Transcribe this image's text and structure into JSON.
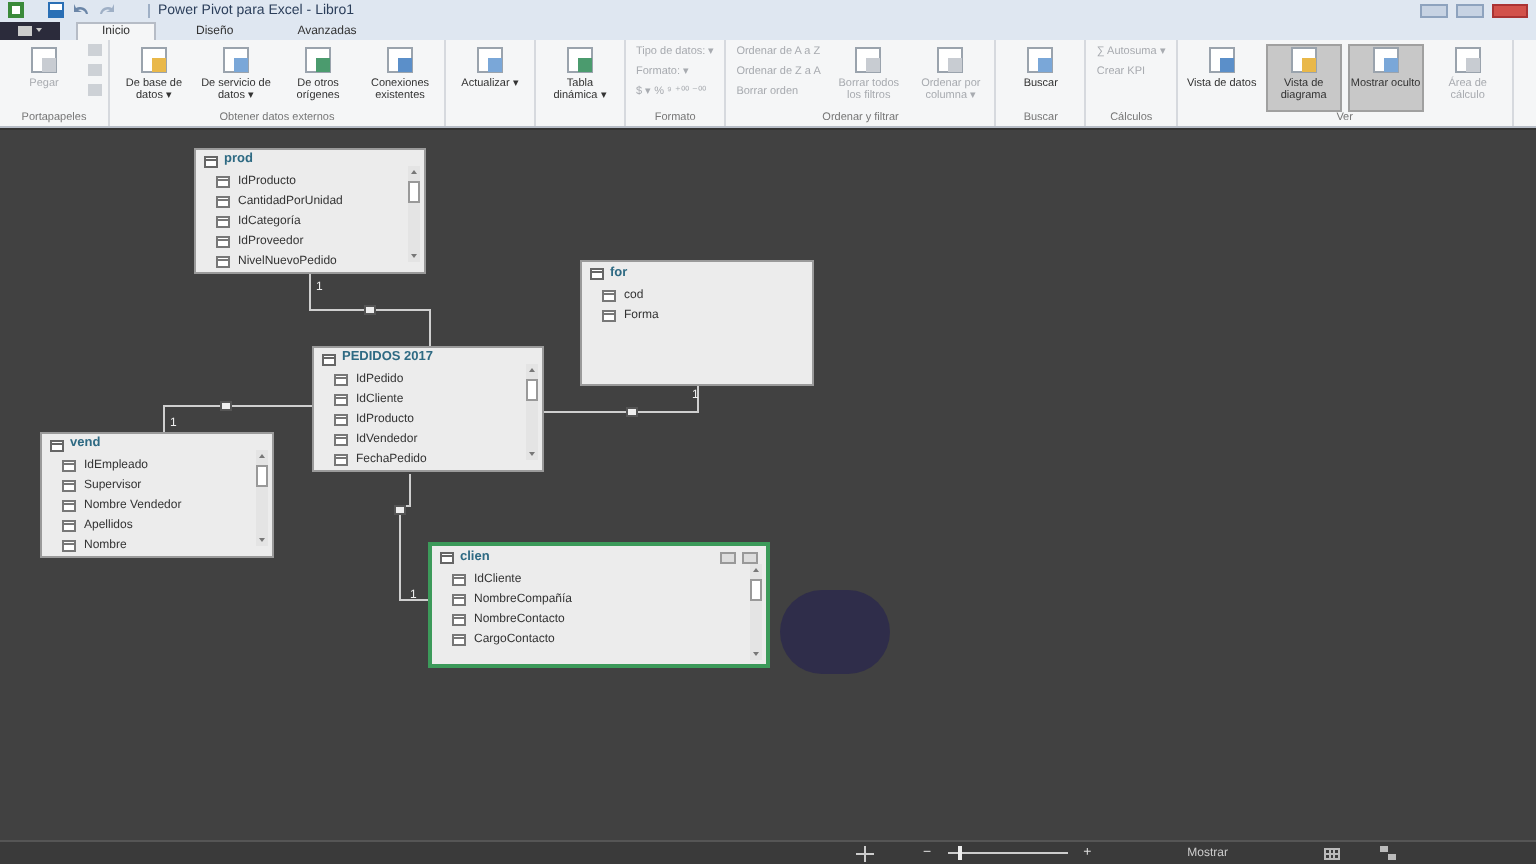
{
  "window": {
    "title": "Power Pivot para Excel - Libro1"
  },
  "tabs": [
    {
      "label": "Inicio",
      "selected": true
    },
    {
      "label": "Diseño",
      "selected": false
    },
    {
      "label": "Avanzadas",
      "selected": false
    }
  ],
  "ribbon": {
    "groups": [
      {
        "label": "Portapapeles",
        "items": [
          {
            "kind": "large",
            "label": "Pegar",
            "disabled": true
          },
          {
            "kind": "stack",
            "disabled": true
          }
        ]
      },
      {
        "label": "Obtener datos externos",
        "items": [
          {
            "kind": "large",
            "label": "De base de datos ▾",
            "disabled": false
          },
          {
            "kind": "large",
            "label": "De servicio de datos ▾",
            "disabled": false
          },
          {
            "kind": "large",
            "label": "De otros orígenes",
            "disabled": false
          },
          {
            "kind": "large",
            "label": "Conexiones existentes",
            "disabled": false
          }
        ]
      },
      {
        "items": [
          {
            "kind": "large",
            "label": "Actualizar ▾",
            "disabled": false
          }
        ]
      },
      {
        "items": [
          {
            "kind": "large",
            "label": "Tabla dinámica ▾",
            "disabled": false
          }
        ]
      },
      {
        "label": "Formato",
        "items": [
          {
            "kind": "small",
            "label": "Tipo de datos: ▾",
            "disabled": true
          },
          {
            "kind": "small",
            "label": "Formato: ▾",
            "disabled": true
          },
          {
            "kind": "small",
            "label": "$ ▾  %  ⁹  ⁺⁰⁰ ⁻⁰⁰",
            "disabled": true
          }
        ]
      },
      {
        "label": "Ordenar y filtrar",
        "items": [
          {
            "kind": "small",
            "label": "Ordenar de A a Z",
            "disabled": true
          },
          {
            "kind": "small",
            "label": "Ordenar de Z a A",
            "disabled": true
          },
          {
            "kind": "small",
            "label": "Borrar orden",
            "disabled": true
          },
          {
            "kind": "large",
            "label": "Borrar todos los filtros",
            "disabled": true
          },
          {
            "kind": "large",
            "label": "Ordenar por columna ▾",
            "disabled": true
          }
        ]
      },
      {
        "label": "Buscar",
        "items": [
          {
            "kind": "large",
            "label": "Buscar",
            "disabled": false
          }
        ]
      },
      {
        "label": "Cálculos",
        "items": [
          {
            "kind": "small",
            "label": "∑ Autosuma ▾",
            "disabled": true
          },
          {
            "kind": "small",
            "label": "Crear KPI",
            "disabled": true
          }
        ]
      },
      {
        "label": "Ver",
        "items": [
          {
            "kind": "large",
            "label": "Vista de datos",
            "disabled": false,
            "selected": false
          },
          {
            "kind": "large",
            "label": "Vista de diagrama",
            "disabled": false,
            "selected": true
          },
          {
            "kind": "large",
            "label": "Mostrar oculto",
            "disabled": false,
            "selected": true
          },
          {
            "kind": "large",
            "label": "Área de cálculo",
            "disabled": true,
            "selected": false
          }
        ]
      }
    ]
  },
  "diagram": {
    "tables": [
      {
        "name": "prod",
        "selected": false,
        "columns": [
          "IdProducto",
          "CantidadPorUnidad",
          "IdCategoría",
          "IdProveedor",
          "NivelNuevoPedido"
        ]
      },
      {
        "name": "for",
        "selected": false,
        "columns": [
          "cod",
          "Forma"
        ]
      },
      {
        "name": "PEDIDOS 2017",
        "selected": false,
        "columns": [
          "IdPedido",
          "IdCliente",
          "IdProducto",
          "IdVendedor",
          "FechaPedido"
        ]
      },
      {
        "name": "vend",
        "selected": false,
        "columns": [
          "IdEmpleado",
          "Supervisor",
          "Nombre Vendedor",
          "Apellidos",
          "Nombre"
        ]
      },
      {
        "name": "clien",
        "selected": true,
        "columns": [
          "IdCliente",
          "NombreCompañía",
          "NombreContacto",
          "CargoContacto"
        ]
      }
    ],
    "relationships": [
      {
        "one_label": "1"
      },
      {
        "one_label": "1"
      },
      {
        "one_label": "1"
      },
      {
        "one_label": "1"
      }
    ]
  },
  "status_bar": {
    "zoom": {
      "minus": "−",
      "plus": "+",
      "level": 0.1
    },
    "show_label": "Mostrar"
  }
}
